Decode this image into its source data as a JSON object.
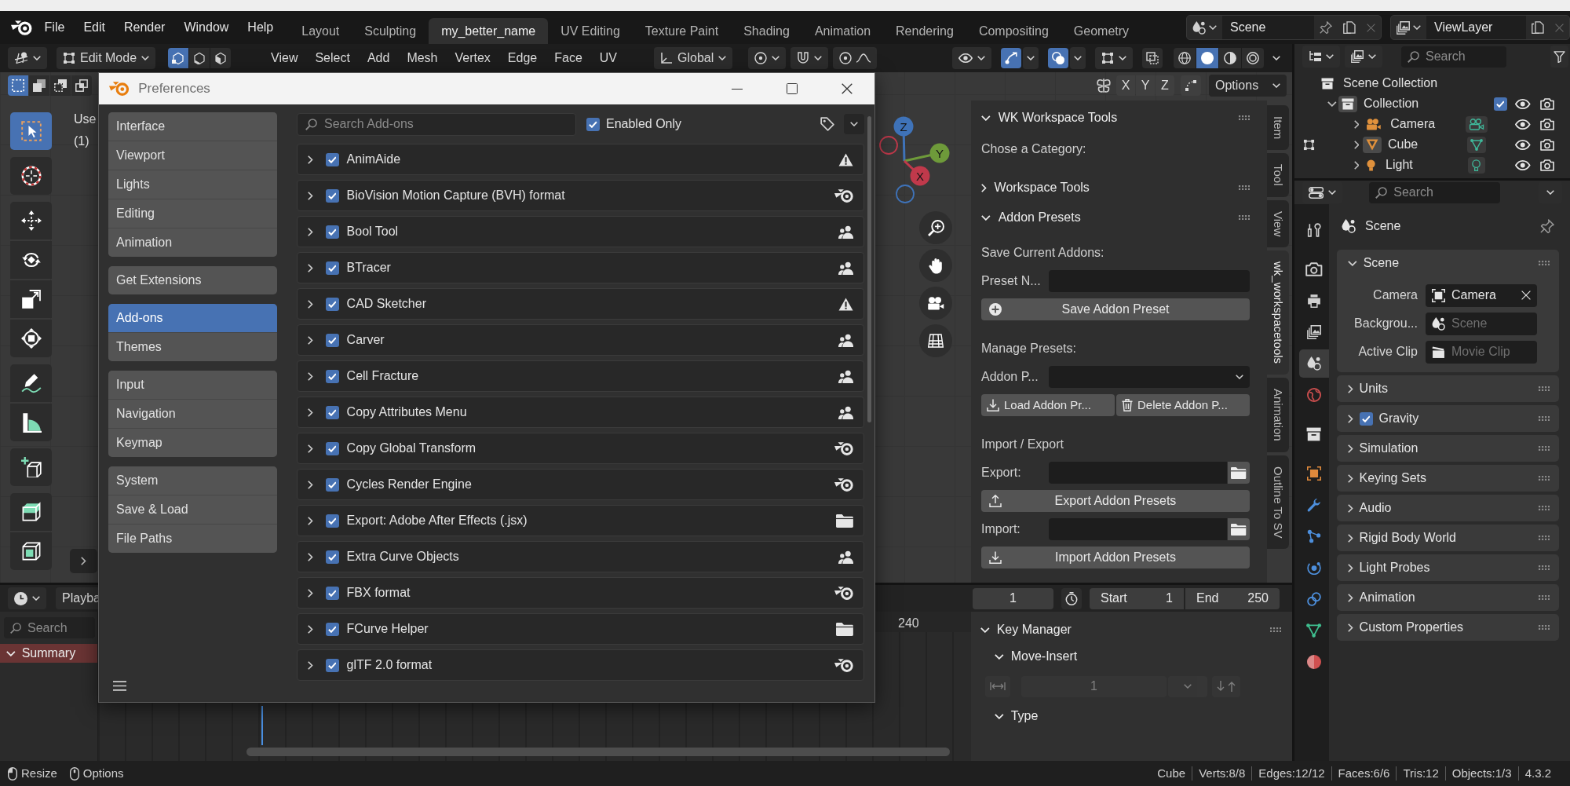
{
  "top_bar": {
    "menus": [
      "File",
      "Edit",
      "Render",
      "Window",
      "Help"
    ],
    "workspaces": [
      {
        "label": "Layout",
        "selected": false
      },
      {
        "label": "Sculpting",
        "selected": false
      },
      {
        "label": "my_better_name",
        "selected": true
      },
      {
        "label": "UV Editing",
        "selected": false
      },
      {
        "label": "Texture Paint",
        "selected": false
      },
      {
        "label": "Shading",
        "selected": false
      },
      {
        "label": "Animation",
        "selected": false
      },
      {
        "label": "Rendering",
        "selected": false
      },
      {
        "label": "Compositing",
        "selected": false
      },
      {
        "label": "Geometry",
        "selected": false
      }
    ],
    "scene": "Scene",
    "view_layer": "ViewLayer"
  },
  "viewport_header": {
    "mode": "Edit Mode",
    "select_modes": [
      {
        "kind": "vertex",
        "selected": true
      },
      {
        "kind": "edge",
        "selected": false
      },
      {
        "kind": "face",
        "selected": false
      }
    ],
    "menus": [
      "View",
      "Select",
      "Add",
      "Mesh",
      "Vertex",
      "Edge",
      "Face",
      "UV"
    ],
    "orientation": "Global",
    "gizmos": true,
    "overlays": true,
    "shading": [
      {
        "kind": "wireframe",
        "selected": false
      },
      {
        "kind": "solid",
        "selected": true
      },
      {
        "kind": "material",
        "selected": false
      },
      {
        "kind": "rendered",
        "selected": false
      }
    ]
  },
  "tool_header": {
    "box_modes": [
      {
        "kind": "new",
        "selected": true
      },
      {
        "kind": "extend",
        "selected": false
      },
      {
        "kind": "subtract",
        "selected": false
      },
      {
        "kind": "intersect",
        "selected": false
      }
    ],
    "mirror_axes": [
      "X",
      "Y",
      "Z"
    ],
    "options": "Options"
  },
  "viewport": {
    "info_lines": [
      "Use",
      "(1)"
    ],
    "tools": [
      {
        "kind": "select_box",
        "selected": true
      },
      {
        "kind": "cursor",
        "selected": false
      },
      {
        "kind": "move",
        "selected": false
      },
      {
        "kind": "rotate",
        "selected": false
      },
      {
        "kind": "scale",
        "selected": false
      },
      {
        "kind": "transform",
        "selected": false
      },
      {
        "kind": "annotate",
        "selected": false
      },
      {
        "kind": "measure",
        "selected": false
      },
      {
        "kind": "add_cube",
        "selected": false
      },
      {
        "kind": "extrude",
        "selected": false
      },
      {
        "kind": "inset",
        "selected": false
      }
    ],
    "gizmo_axes": [
      "Z",
      "Y",
      "X"
    ]
  },
  "preferences": {
    "title": "Preferences",
    "nav_groups": [
      {
        "items": [
          {
            "label": "Interface",
            "selected": false
          },
          {
            "label": "Viewport",
            "selected": false
          },
          {
            "label": "Lights",
            "selected": false
          },
          {
            "label": "Editing",
            "selected": false
          },
          {
            "label": "Animation",
            "selected": false
          }
        ]
      },
      {
        "items": [
          {
            "label": "Get Extensions",
            "selected": false
          }
        ]
      },
      {
        "items": [
          {
            "label": "Add-ons",
            "selected": true
          },
          {
            "label": "Themes",
            "selected": false
          }
        ]
      },
      {
        "items": [
          {
            "label": "Input",
            "selected": false
          },
          {
            "label": "Navigation",
            "selected": false
          },
          {
            "label": "Keymap",
            "selected": false
          }
        ]
      },
      {
        "items": [
          {
            "label": "System",
            "selected": false
          },
          {
            "label": "Save & Load",
            "selected": false
          },
          {
            "label": "File Paths",
            "selected": false
          }
        ]
      }
    ],
    "search_placeholder": "Search Add-ons",
    "enabled_only": {
      "label": "Enabled Only",
      "checked": true
    },
    "addons": [
      {
        "name": "AnimAide",
        "expanded": false,
        "enabled": true,
        "kind": "warning"
      },
      {
        "name": "BioVision Motion Capture (BVH) format",
        "expanded": false,
        "enabled": true,
        "kind": "core"
      },
      {
        "name": "Bool Tool",
        "expanded": false,
        "enabled": true,
        "kind": "community"
      },
      {
        "name": "BTracer",
        "expanded": false,
        "enabled": true,
        "kind": "community"
      },
      {
        "name": "CAD Sketcher",
        "expanded": false,
        "enabled": true,
        "kind": "warning"
      },
      {
        "name": "Carver",
        "expanded": false,
        "enabled": true,
        "kind": "community"
      },
      {
        "name": "Cell Fracture",
        "expanded": false,
        "enabled": true,
        "kind": "community"
      },
      {
        "name": "Copy Attributes Menu",
        "expanded": false,
        "enabled": true,
        "kind": "community"
      },
      {
        "name": "Copy Global Transform",
        "expanded": false,
        "enabled": true,
        "kind": "core"
      },
      {
        "name": "Cycles Render Engine",
        "expanded": false,
        "enabled": true,
        "kind": "core"
      },
      {
        "name": "Export: Adobe After Effects (.jsx)",
        "expanded": false,
        "enabled": true,
        "kind": "local"
      },
      {
        "name": "Extra Curve Objects",
        "expanded": false,
        "enabled": true,
        "kind": "community"
      },
      {
        "name": "FBX format",
        "expanded": false,
        "enabled": true,
        "kind": "core"
      },
      {
        "name": "FCurve Helper",
        "expanded": false,
        "enabled": true,
        "kind": "local"
      },
      {
        "name": "glTF 2.0 format",
        "expanded": false,
        "enabled": true,
        "kind": "core"
      }
    ]
  },
  "sidebar": {
    "tabs": [
      {
        "label": "Item",
        "selected": false
      },
      {
        "label": "Tool",
        "selected": false
      },
      {
        "label": "View",
        "selected": false
      },
      {
        "label": "wk_workspacetools",
        "selected": true
      },
      {
        "label": "Animation",
        "selected": false
      },
      {
        "label": "Outline To SV",
        "selected": false
      }
    ],
    "panel": {
      "title": "WK Workspace Tools",
      "expanded": true,
      "category_label": "Chose a Category:",
      "sections": [
        {
          "title": "Workspace Tools",
          "expanded": false
        },
        {
          "title": "Addon Presets",
          "expanded": true,
          "rows": [
            {
              "kind": "label",
              "text": "Save Current Addons:"
            },
            {
              "kind": "field",
              "label": "Preset N..."
            },
            {
              "kind": "save_button",
              "label": "Save Addon Preset"
            },
            {
              "kind": "label",
              "text": "Manage Presets:"
            },
            {
              "kind": "dropdown",
              "label": "Addon P..."
            },
            {
              "kind": "button_pair",
              "buttons": [
                {
                  "kind": "load",
                  "label": "Load Addon Pr..."
                },
                {
                  "kind": "delete",
                  "label": "Delete Addon P..."
                }
              ]
            },
            {
              "kind": "label",
              "text": "Import / Export"
            },
            {
              "kind": "file",
              "label": "Export:"
            },
            {
              "kind": "export_button",
              "label": "Export Addon Presets"
            },
            {
              "kind": "file",
              "label": "Import:"
            },
            {
              "kind": "import_button",
              "label": "Import Addon Presets"
            }
          ]
        }
      ]
    }
  },
  "timeline": {
    "menu": "Playba",
    "current_frame": "1",
    "start_label": "Start",
    "start_frame": "1",
    "end_label": "End",
    "end_frame": "250",
    "search_placeholder": "Search",
    "channels": [
      {
        "label": "Summary",
        "expanded": true
      }
    ],
    "frame_labels": [
      "240"
    ],
    "key_manager": {
      "title": "Key Manager",
      "expanded": true,
      "sections": [
        {
          "title": "Move-Insert",
          "expanded": true,
          "step": "1",
          "disabled": true
        },
        {
          "title": "Type",
          "expanded": true
        }
      ]
    }
  },
  "outliner": {
    "search_placeholder": "Search",
    "tree": [
      {
        "label": "Scene Collection",
        "kind": "scene_collection",
        "children": [
          {
            "label": "Collection",
            "kind": "collection",
            "expanded": true,
            "active": true,
            "checked": true,
            "children": [
              {
                "label": "Camera",
                "kind": "camera",
                "expanded": false,
                "active": false,
                "edit_mode": false
              },
              {
                "label": "Cube",
                "kind": "mesh",
                "expanded": false,
                "active": true,
                "edit_mode": true
              },
              {
                "label": "Light",
                "kind": "light",
                "expanded": false,
                "active": false,
                "edit_mode": false
              }
            ]
          }
        ]
      }
    ]
  },
  "properties": {
    "search_placeholder": "Search",
    "tabs": [
      {
        "kind": "tool",
        "selected": false
      },
      {
        "kind": "render",
        "selected": false
      },
      {
        "kind": "output",
        "selected": false
      },
      {
        "kind": "view_layer",
        "selected": false
      },
      {
        "kind": "scene",
        "selected": true
      },
      {
        "kind": "world",
        "selected": false
      },
      {
        "kind": "collection",
        "selected": false
      },
      {
        "kind": "object",
        "selected": false
      },
      {
        "kind": "modifiers",
        "selected": false
      },
      {
        "kind": "particles",
        "selected": false
      },
      {
        "kind": "physics",
        "selected": false
      },
      {
        "kind": "constraints",
        "selected": false
      },
      {
        "kind": "data",
        "selected": false
      },
      {
        "kind": "material",
        "selected": false
      }
    ],
    "context": "Scene",
    "panels": [
      {
        "title": "Scene",
        "expanded": true,
        "fields": [
          {
            "label": "Camera",
            "kind": "object",
            "value": "Camera"
          },
          {
            "label": "Backgrou...",
            "kind": "scene",
            "placeholder": "Scene"
          },
          {
            "label": "Active Clip",
            "kind": "clip",
            "placeholder": "Movie Clip"
          }
        ]
      },
      {
        "title": "Units",
        "expanded": false
      },
      {
        "title": "Gravity",
        "expanded": false,
        "checked": true
      },
      {
        "title": "Simulation",
        "expanded": false
      },
      {
        "title": "Keying Sets",
        "expanded": false
      },
      {
        "title": "Audio",
        "expanded": false
      },
      {
        "title": "Rigid Body World",
        "expanded": false
      },
      {
        "title": "Light Probes",
        "expanded": false
      },
      {
        "title": "Animation",
        "expanded": false
      },
      {
        "title": "Custom Properties",
        "expanded": false
      }
    ]
  },
  "status_bar": {
    "hints": [
      {
        "kind": "left_mouse",
        "label": "Resize"
      },
      {
        "kind": "middle_mouse",
        "label": "Options"
      }
    ],
    "stats": [
      "Cube",
      "Verts:8/8",
      "Edges:12/12",
      "Faces:6/6",
      "Tris:12",
      "Objects:1/3",
      "4.3.2"
    ]
  }
}
